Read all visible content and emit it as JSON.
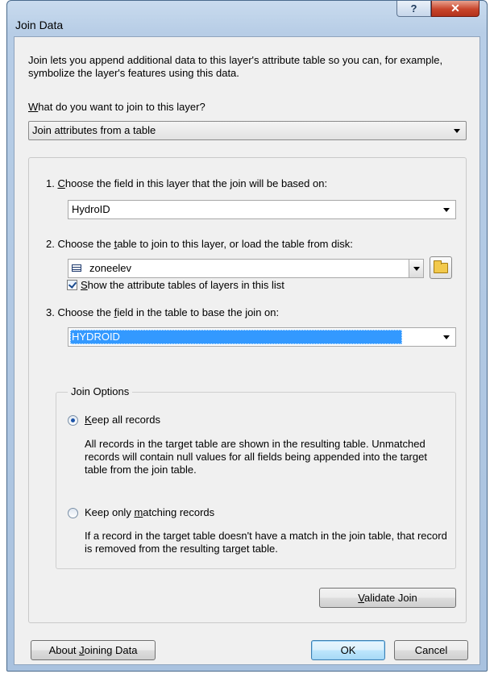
{
  "window": {
    "title": "Join Data",
    "help_label": "?",
    "close_label": "✕"
  },
  "intro_text": "Join lets you append additional data to this layer's attribute table so you can, for example, symbolize the layer's features using this data.",
  "question": {
    "prefix": "W",
    "rest": "hat do you want to join to this layer?"
  },
  "join_type": {
    "selected": "Join attributes from a table"
  },
  "step1": {
    "pre": "1.  ",
    "accel": "C",
    "post": "hoose the field in this layer that the join will be based on:",
    "selected": "HydroID"
  },
  "step2": {
    "pre": "2.  Choose the ",
    "accel": "t",
    "post": "able to join to this layer, or load the table from disk:",
    "selected": "zoneelev",
    "checkbox_accel": "S",
    "checkbox_rest": "how the attribute tables of layers in this list",
    "checkbox_checked": true
  },
  "step3": {
    "pre": "3.  Choose the ",
    "accel": "f",
    "post": "ield in the table to base the join on:",
    "selected": "HYDROID"
  },
  "join_options": {
    "legend": "Join Options",
    "keep_all": {
      "accel": "K",
      "rest": "eep all records",
      "selected": true,
      "description": "All records in the target table are shown in the resulting table. Unmatched records will contain null values for all fields being appended into the target table from the join table."
    },
    "keep_matching": {
      "pre": "Keep only ",
      "accel": "m",
      "post": "atching records",
      "selected": false,
      "description": "If a record in the target table doesn't have a match in the join table, that record is removed from the resulting target table."
    }
  },
  "buttons": {
    "validate": {
      "accel": "V",
      "rest": "alidate Join"
    },
    "about": {
      "pre": "About ",
      "accel": "J",
      "post": "oining Data"
    },
    "ok": "OK",
    "cancel": "Cancel"
  },
  "icons": {
    "table": "table-icon",
    "folder": "open-folder-icon",
    "check": "checkmark-icon"
  },
  "colors": {
    "selection": "#3399ff",
    "title_bar": "#b7cde6",
    "close_button": "#c8452b"
  }
}
